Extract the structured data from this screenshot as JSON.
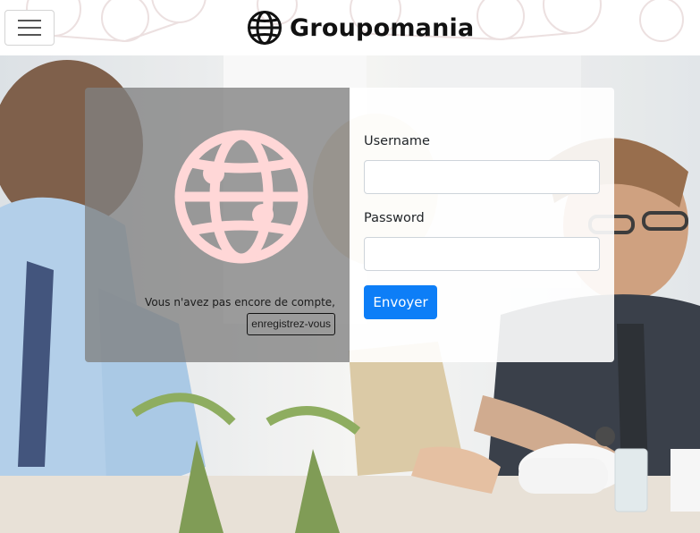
{
  "header": {
    "brand_name": "Groupomania",
    "menu_icon": "hamburger-menu-icon",
    "brand_icon": "globe-icon"
  },
  "login": {
    "logo_icon": "globe-icon",
    "no_account_text": "Vous n'avez pas encore de compte,",
    "register_label": "enregistrez-vous",
    "username_label": "Username",
    "username_value": "",
    "password_label": "Password",
    "password_value": "",
    "submit_label": "Envoyer"
  },
  "colors": {
    "logo_pink": "#ffd7d7",
    "submit_blue": "#0d7ef7",
    "panel_gray": "#808080"
  }
}
